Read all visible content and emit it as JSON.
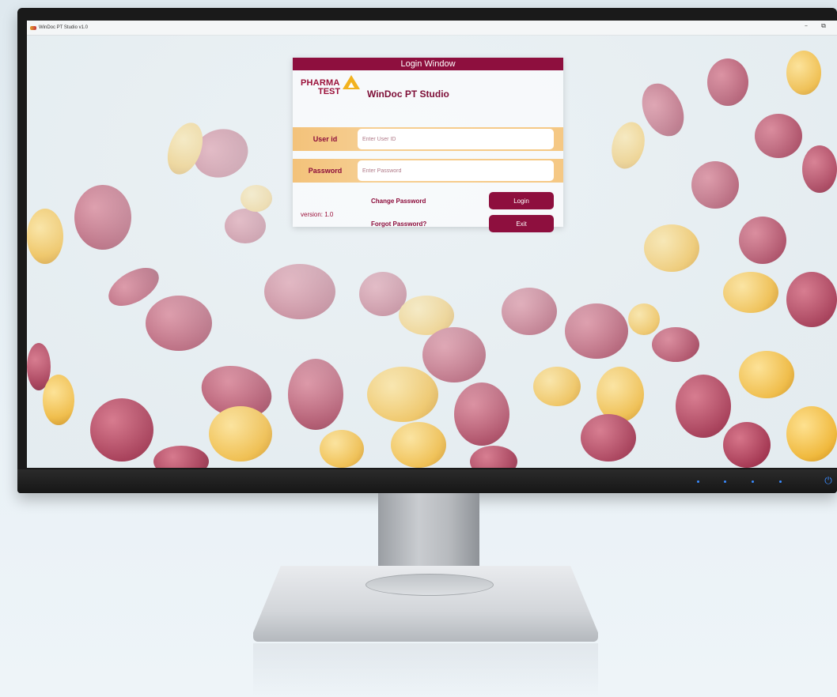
{
  "window": {
    "title": "WinDoc PT Studio v1.0",
    "minimize_glyph": "–",
    "restore_glyph": "⧉"
  },
  "login": {
    "header": "Login Window",
    "logo_line1": "PHARMA",
    "logo_line2": "TEST",
    "app_name": "WinDoc PT Studio",
    "user_id_label": "User id",
    "user_id_placeholder": "Enter User ID",
    "user_id_value": "",
    "password_label": "Password",
    "password_placeholder": "Enter Password",
    "password_value": "",
    "change_password": "Change Password",
    "forgot_password": "Forgot Password?",
    "login_button": "Login",
    "exit_button": "Exit",
    "version": "version: 1.0"
  },
  "colors": {
    "brand": "#8e0f3e",
    "accent": "#f2b21f",
    "field_band": "#f5c884",
    "power_led": "#3a8bff"
  },
  "icons": {
    "app": "pharma-logo-icon",
    "power": "power-icon"
  }
}
